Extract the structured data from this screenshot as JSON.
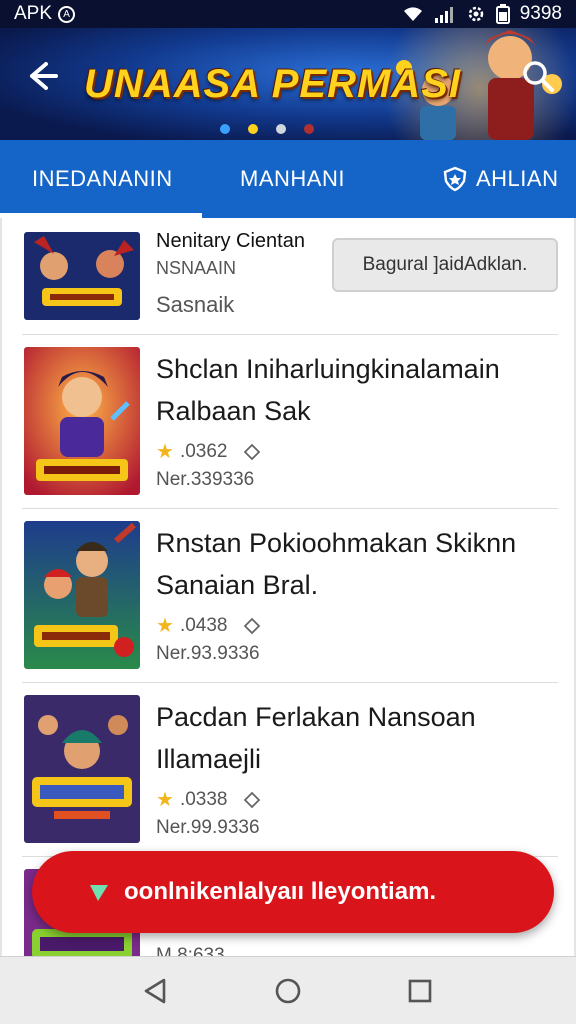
{
  "status_bar": {
    "left_label": "APK",
    "badge": "A",
    "time": "9398"
  },
  "header": {
    "title": "UNAASA PERMASI"
  },
  "tabs": [
    {
      "label": "INEDANANIN",
      "active": true
    },
    {
      "label": "MANHANI",
      "active": false
    },
    {
      "label": "AHLIAN",
      "active": false
    }
  ],
  "featured": {
    "title": "Nenitary Cientan",
    "subtitle": "NSNAAIN",
    "extra": "Sasnaik",
    "button_label": "Bagural ]aidAdklan."
  },
  "items": [
    {
      "title_line1": "Shclan Iniharluingkinalamain",
      "title_line2": "Ralbaan Sak",
      "rating": ".0362",
      "size": "Ner.339336"
    },
    {
      "title_line1": "Rnstan Pokioohmakan Skiknn",
      "title_line2": "Sanaian Bral.",
      "rating": ".0438",
      "size": "Ner.93.9336"
    },
    {
      "title_line1": "Pacdan Ferlakan Nansoan",
      "title_line2": "Illamaejli",
      "rating": ".0338",
      "size": "Ner.99.9336"
    },
    {
      "title_line1": "",
      "title_line2": "",
      "rating": "",
      "size": "M 8:633"
    }
  ],
  "cta": {
    "label": "oonlnikenlalyaıı lleyontiam."
  },
  "colors": {
    "tab_bar": "#1565c8",
    "cta": "#d9141a",
    "star": "#f2b51c",
    "title_gold": "#ffd21e"
  }
}
